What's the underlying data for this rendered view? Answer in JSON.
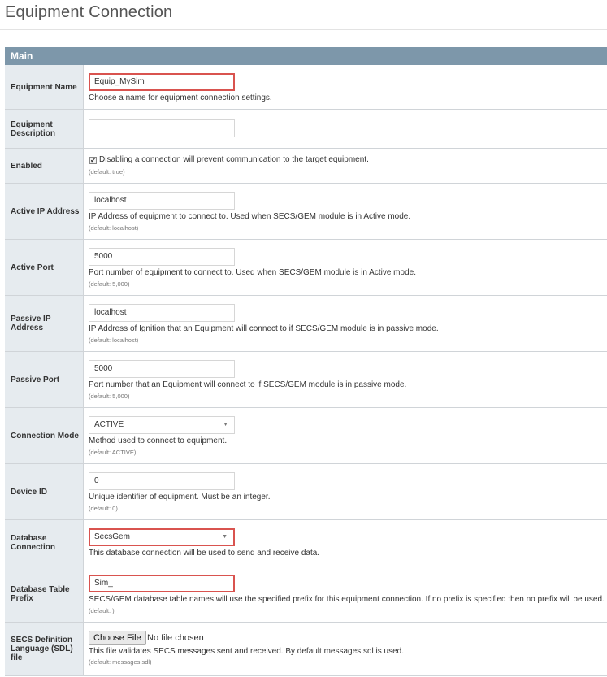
{
  "page": {
    "title": "Equipment Connection"
  },
  "section": {
    "title": "Main"
  },
  "fields": {
    "equipment_name": {
      "label": "Equipment Name",
      "value": "Equip_MySim",
      "description": "Choose a name for equipment connection settings."
    },
    "equipment_description": {
      "label": "Equipment Description",
      "value": ""
    },
    "enabled": {
      "label": "Enabled",
      "checked": true,
      "check_mark": "✔",
      "description": "Disabling a connection will prevent communication to the target equipment.",
      "default": "(default: true)"
    },
    "active_ip": {
      "label": "Active IP Address",
      "value": "localhost",
      "description": "IP Address of equipment to connect to. Used when SECS/GEM module is in Active mode.",
      "default": "(default: localhost)"
    },
    "active_port": {
      "label": "Active Port",
      "value": "5000",
      "description": "Port number of equipment to connect to. Used when SECS/GEM module is in Active mode.",
      "default": "(default: 5,000)"
    },
    "passive_ip": {
      "label": "Passive IP Address",
      "value": "localhost",
      "description": "IP Address of Ignition that an Equipment will connect to if SECS/GEM module is in passive mode.",
      "default": "(default: localhost)"
    },
    "passive_port": {
      "label": "Passive Port",
      "value": "5000",
      "description": "Port number that an Equipment will connect to if SECS/GEM module is in passive mode.",
      "default": "(default: 5,000)"
    },
    "connection_mode": {
      "label": "Connection Mode",
      "value": "ACTIVE",
      "description": "Method used to connect to equipment.",
      "default": "(default: ACTIVE)"
    },
    "device_id": {
      "label": "Device ID",
      "value": "0",
      "description": "Unique identifier of equipment. Must be an integer.",
      "default": "(default: 0)"
    },
    "database_connection": {
      "label": "Database Connection",
      "value": "SecsGem",
      "description": "This database connection will be used to send and receive data."
    },
    "database_table_prefix": {
      "label": "Database Table Prefix",
      "value": "Sim_",
      "description": "SECS/GEM database table names will use the specified prefix for this equipment connection. If no prefix is specified then no prefix will be used.",
      "default": "(default: )"
    },
    "sdl_file": {
      "label": "SECS Definition Language (SDL) file",
      "button_label": "Choose File",
      "file_status": "No file chosen",
      "description": "This file validates SECS messages sent and received. By default messages.sdl is used.",
      "default": "(default: messages.sdl)"
    }
  },
  "icons": {
    "dropdown": "chevron-down-icon",
    "dropdown_glyph": "▼"
  },
  "colors": {
    "header_bg": "#7d97aa",
    "label_bg": "#e6ebef",
    "highlight_border": "#d9534f"
  }
}
